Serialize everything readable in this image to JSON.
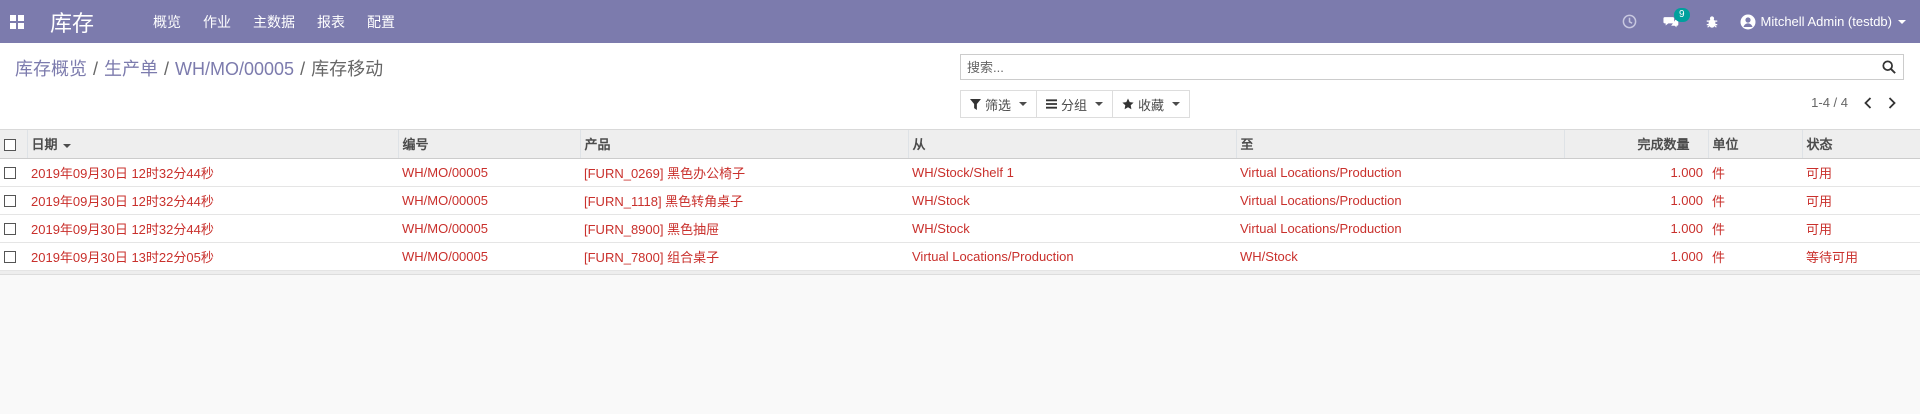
{
  "navbar": {
    "brand": "库存",
    "menu": [
      "概览",
      "作业",
      "主数据",
      "报表",
      "配置"
    ],
    "messages_count": "9",
    "user": "Mitchell Admin (testdb)"
  },
  "breadcrumb": {
    "items": [
      "库存概览",
      "生产单",
      "WH/MO/00005"
    ],
    "current": "库存移动",
    "separator": "/"
  },
  "search": {
    "placeholder": "搜索..."
  },
  "filters": {
    "filter": "筛选",
    "group": "分组",
    "favorites": "收藏"
  },
  "pager": {
    "text": "1-4 / 4"
  },
  "table": {
    "columns": {
      "date": "日期",
      "reference": "编号",
      "product": "产品",
      "from": "从",
      "to": "至",
      "qty_done": "完成数量",
      "uom": "单位",
      "state": "状态"
    },
    "rows": [
      {
        "date": "2019年09月30日 12时32分44秒",
        "reference": "WH/MO/00005",
        "product": "[FURN_0269] 黑色办公椅子",
        "from": "WH/Stock/Shelf 1",
        "to": "Virtual Locations/Production",
        "qty": "1.000",
        "uom": "件",
        "state": "可用"
      },
      {
        "date": "2019年09月30日 12时32分44秒",
        "reference": "WH/MO/00005",
        "product": "[FURN_1118] 黑色转角桌子",
        "from": "WH/Stock",
        "to": "Virtual Locations/Production",
        "qty": "1.000",
        "uom": "件",
        "state": "可用"
      },
      {
        "date": "2019年09月30日 12时32分44秒",
        "reference": "WH/MO/00005",
        "product": "[FURN_8900] 黑色抽屉",
        "from": "WH/Stock",
        "to": "Virtual Locations/Production",
        "qty": "1.000",
        "uom": "件",
        "state": "可用"
      },
      {
        "date": "2019年09月30日 13时22分05秒",
        "reference": "WH/MO/00005",
        "product": "[FURN_7800] 组合桌子",
        "from": "Virtual Locations/Production",
        "to": "WH/Stock",
        "qty": "1.000",
        "uom": "件",
        "state": "等待可用"
      }
    ]
  },
  "colors": {
    "navbar": "#7c7bad",
    "link": "#7c7bad",
    "row_text": "#c9302c"
  }
}
